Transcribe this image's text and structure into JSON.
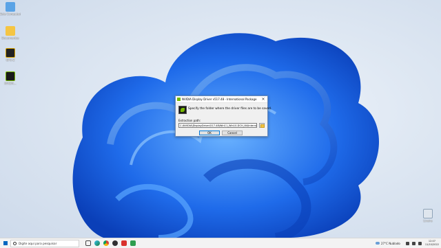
{
  "desktop": {
    "icons": [
      {
        "label": "Este Computador",
        "icon": "computer-icon",
        "color": "#5aa3e6"
      },
      {
        "label": "Documentos",
        "icon": "folder-icon",
        "color": "#f5c543"
      },
      {
        "label": "GPU-Z",
        "icon": "gpuz-icon",
        "color": "#d9a400"
      },
      {
        "label": "NVIDIA...",
        "icon": "nvidia-installer-icon",
        "color": "#76b900"
      }
    ],
    "recycle_bin": {
      "label": "Lixeira",
      "icon": "recycle-bin-icon"
    }
  },
  "dialog": {
    "title": "NVIDIA Display Driver v517.48 - International Package",
    "instruction": "Specify the folder where the driver files are to be saved.",
    "path_label": "Extraction path:",
    "path_value": "C:\\NVIDIA\\DisplayDriver\\517.48\\Win11_Win10-DCH_64\\International",
    "ok_label": "OK",
    "cancel_label": "Cancel"
  },
  "taskbar": {
    "search_placeholder": "Digite aqui para pesquisar",
    "apps": [
      "task-view-icon",
      "edge-icon",
      "chrome-icon",
      "obs-icon",
      "red-app-icon",
      "green-app-icon"
    ],
    "weather_temp": "27°C",
    "weather_desc": "Nublado",
    "time": "12:07",
    "date": "11/10/2022"
  },
  "colors": {
    "accent": "#0078d7",
    "nvidia_green": "#76b900",
    "bloom_dark": "#0a3fb8",
    "bloom_light": "#3d8cff"
  }
}
